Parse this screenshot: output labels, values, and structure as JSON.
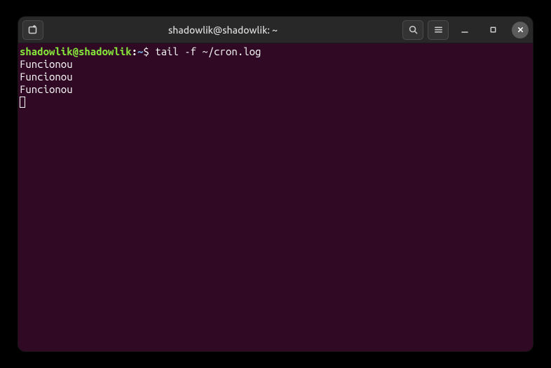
{
  "titlebar": {
    "title": "shadowlik@shadowlik: ~"
  },
  "terminal": {
    "prompt": {
      "user_host": "shadowlik@shadowlik",
      "colon": ":",
      "path": "~",
      "symbol": "$"
    },
    "command": "tail -f ~/cron.log",
    "output": [
      "Funcionou",
      "Funcionou",
      "Funcionou"
    ]
  }
}
